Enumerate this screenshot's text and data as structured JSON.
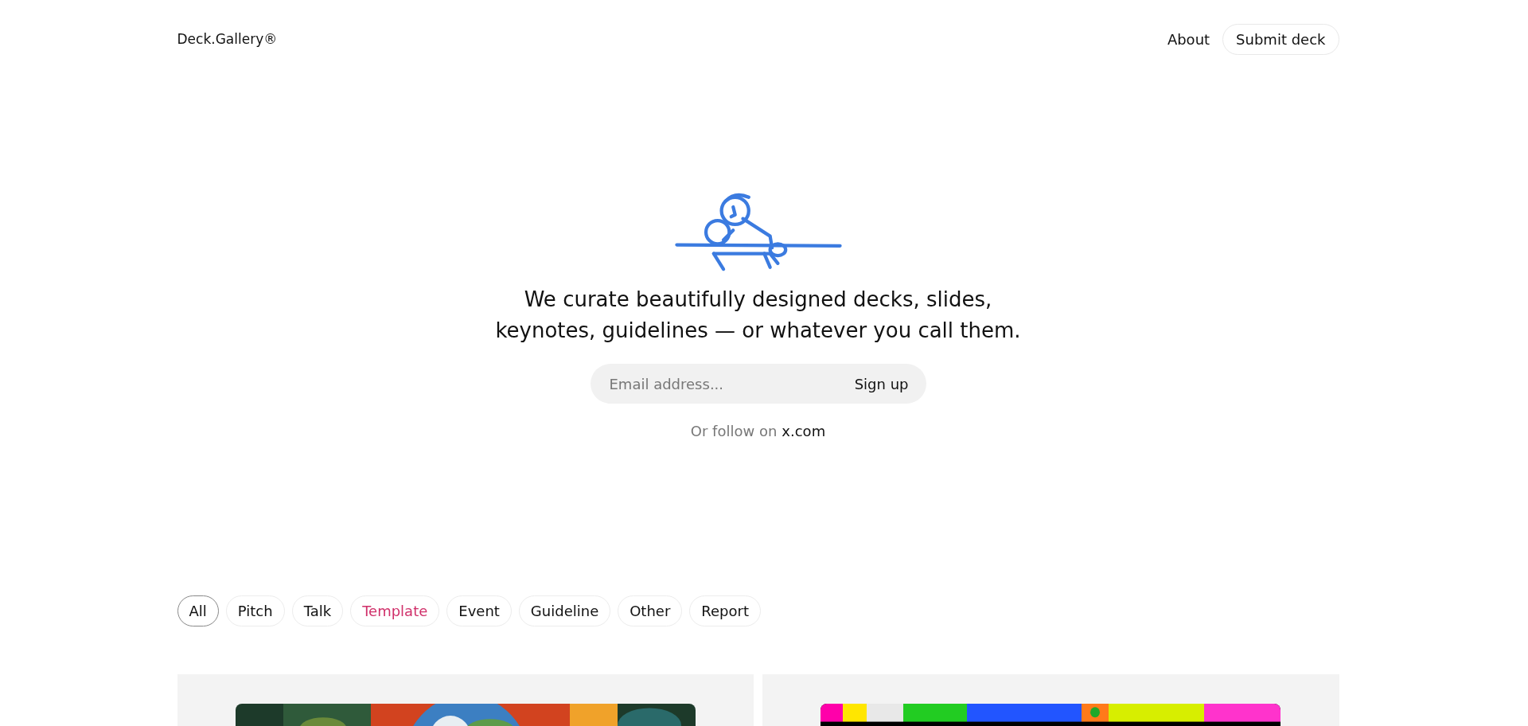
{
  "header": {
    "logo": "Deck.Gallery®",
    "nav": [
      {
        "label": "About",
        "kind": "link"
      },
      {
        "label": "Submit deck",
        "kind": "button"
      }
    ]
  },
  "hero": {
    "headline_lines": [
      "We curate beautifully designed decks, slides,",
      "keynotes, guidelines — or whatever you call them."
    ],
    "email": {
      "placeholder": "Email address...",
      "button": "Sign up"
    },
    "follow": {
      "text": "Or follow on",
      "link": "x.com"
    }
  },
  "filters": [
    {
      "label": "All",
      "selected": true,
      "hovered": false
    },
    {
      "label": "Pitch",
      "selected": false,
      "hovered": false
    },
    {
      "label": "Talk",
      "selected": false,
      "hovered": false
    },
    {
      "label": "Template",
      "selected": false,
      "hovered": true
    },
    {
      "label": "Event",
      "selected": false,
      "hovered": false
    },
    {
      "label": "Guideline",
      "selected": false,
      "hovered": false
    },
    {
      "label": "Other",
      "selected": false,
      "hovered": false
    },
    {
      "label": "Report",
      "selected": false,
      "hovered": false
    }
  ]
}
